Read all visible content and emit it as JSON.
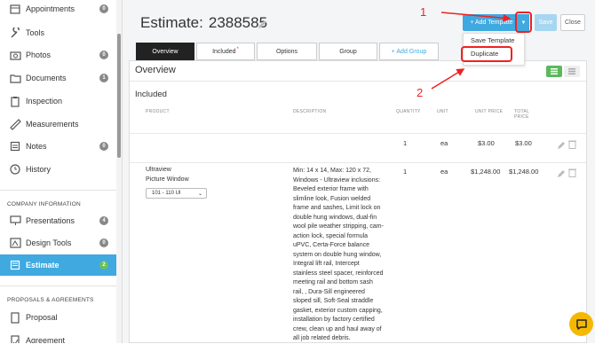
{
  "sidebar": {
    "items": [
      {
        "label": "Appointments",
        "badge": "0",
        "icon": "calendar-icon"
      },
      {
        "label": "Tools",
        "badge": "",
        "icon": "tools-icon"
      },
      {
        "label": "Photos",
        "badge": "0",
        "icon": "camera-icon"
      },
      {
        "label": "Documents",
        "badge": "1",
        "icon": "folder-icon"
      },
      {
        "label": "Inspection",
        "badge": "",
        "icon": "clipboard-icon"
      },
      {
        "label": "Measurements",
        "badge": "",
        "icon": "ruler-icon"
      },
      {
        "label": "Notes",
        "badge": "0",
        "icon": "note-icon"
      },
      {
        "label": "History",
        "badge": "",
        "icon": "clock-icon"
      }
    ],
    "company_section_title": "COMPANY INFORMATION",
    "company_items": [
      {
        "label": "Presentations",
        "badge": "4",
        "icon": "presentation-icon"
      },
      {
        "label": "Design Tools",
        "badge": "0",
        "icon": "design-icon"
      },
      {
        "label": "Estimate",
        "badge": "2",
        "icon": "estimate-icon",
        "active": true
      }
    ],
    "proposals_section_title": "PROPOSALS & AGREEMENTS",
    "proposal_items": [
      {
        "label": "Proposal",
        "badge": "",
        "icon": "proposal-icon"
      },
      {
        "label": "Agreement",
        "badge": "",
        "icon": "agreement-icon"
      }
    ]
  },
  "header": {
    "title": "Estimate:",
    "estimate_number": "2388585",
    "add_template_label": "+ Add Template",
    "save_label": "Save",
    "close_label": "Close"
  },
  "dropdown": {
    "options": [
      "Save Template",
      "Duplicate"
    ]
  },
  "tabs": [
    {
      "label": "Overview",
      "active": true
    },
    {
      "label": "Included",
      "star": "*"
    },
    {
      "label": "Options"
    },
    {
      "label": "Group"
    },
    {
      "label": "+ Add Group"
    }
  ],
  "overview": {
    "heading": "Overview",
    "included_heading": "Included",
    "columns": [
      "PRODUCT",
      "DESCRIPTION",
      "QUANTITY",
      "UNIT",
      "UNIT PRICE",
      "TOTAL PRICE"
    ],
    "rows": [
      {
        "product": "",
        "description": "",
        "quantity": "1",
        "unit": "ea",
        "unit_price": "$3.00",
        "total_price": "$3.00"
      },
      {
        "product_line1": "Ultraview",
        "product_line2": "Picture Window",
        "variant": "101 - 110 UI",
        "description": "Min: 14 x 14, Max: 120 x 72, Windows - Ultraview inclusions: Beveled exterior frame with slimline look, Fusion welded frame and sashes, Limit lock on double hung windows, dual-fin wool pile weather stripping, cam-action lock, special formula uPVC, Certa-Force balance system on double hung window, Integral lift rail, Intercept stainless steel spacer, reinforced meeting rail and bottom sash rail, , Dura-Sill engineered sloped sill, Soft-Seal straddle gasket, exterior custom capping, installation by factory certified crew, clean up and haul away of all job related debris.",
        "quantity": "1",
        "unit": "ea",
        "unit_price": "$1,248.00",
        "total_price": "$1,248.00"
      }
    ]
  },
  "annotations": {
    "step1": "1",
    "step2": "2",
    "color": "#e22222"
  },
  "colors": {
    "accent": "#3fa9e0",
    "active_tab": "#222222",
    "badge_green": "#6cc05a",
    "chat": "#f5b800"
  }
}
